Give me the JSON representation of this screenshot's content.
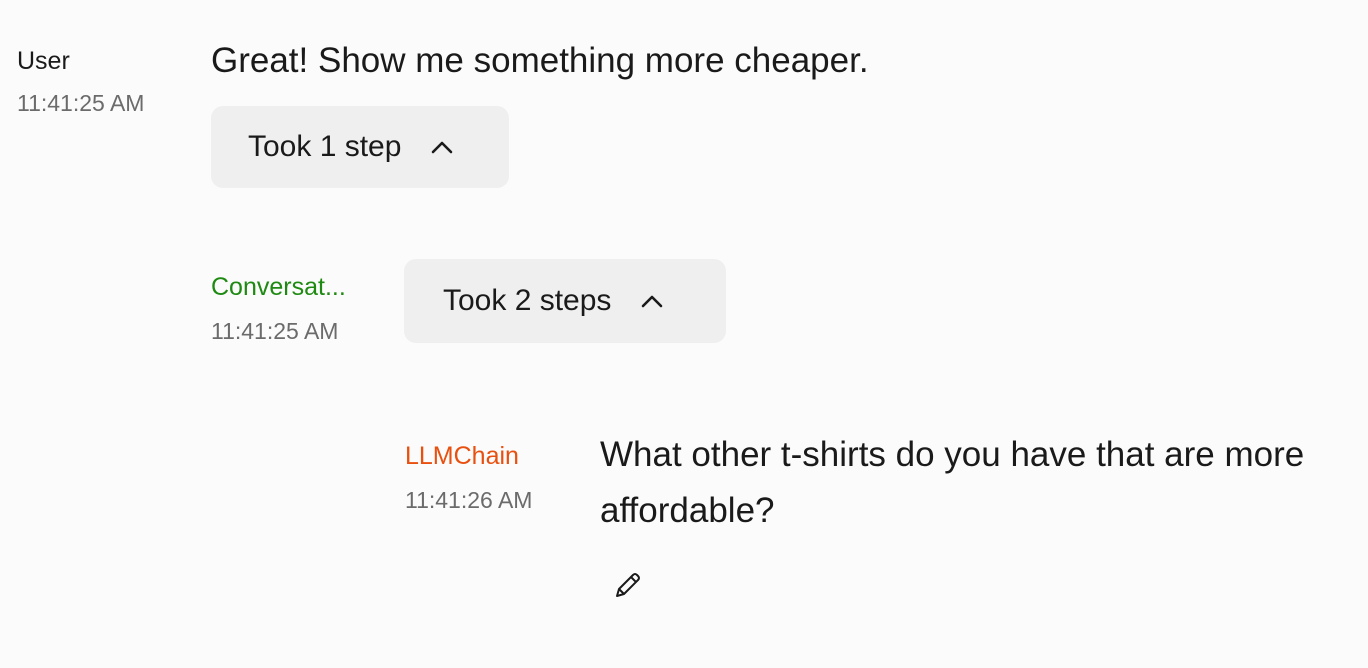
{
  "messages": [
    {
      "author": "User",
      "author_color": "#1a1a1a",
      "timestamp": "11:41:25 AM",
      "text": "Great! Show me something more cheaper.",
      "steps_label": "Took 1 step"
    },
    {
      "author": "Conversat...",
      "author_color": "#1f8a12",
      "timestamp": "11:41:25 AM",
      "steps_label": "Took 2 steps"
    },
    {
      "author": "LLMChain",
      "author_color": "#e8500f",
      "timestamp": "11:41:26 AM",
      "text": "What other t-shirts do you have that are more affordable?"
    }
  ],
  "icons": {
    "steps_toggle": "chevron-up-icon",
    "edit": "pencil-icon"
  }
}
